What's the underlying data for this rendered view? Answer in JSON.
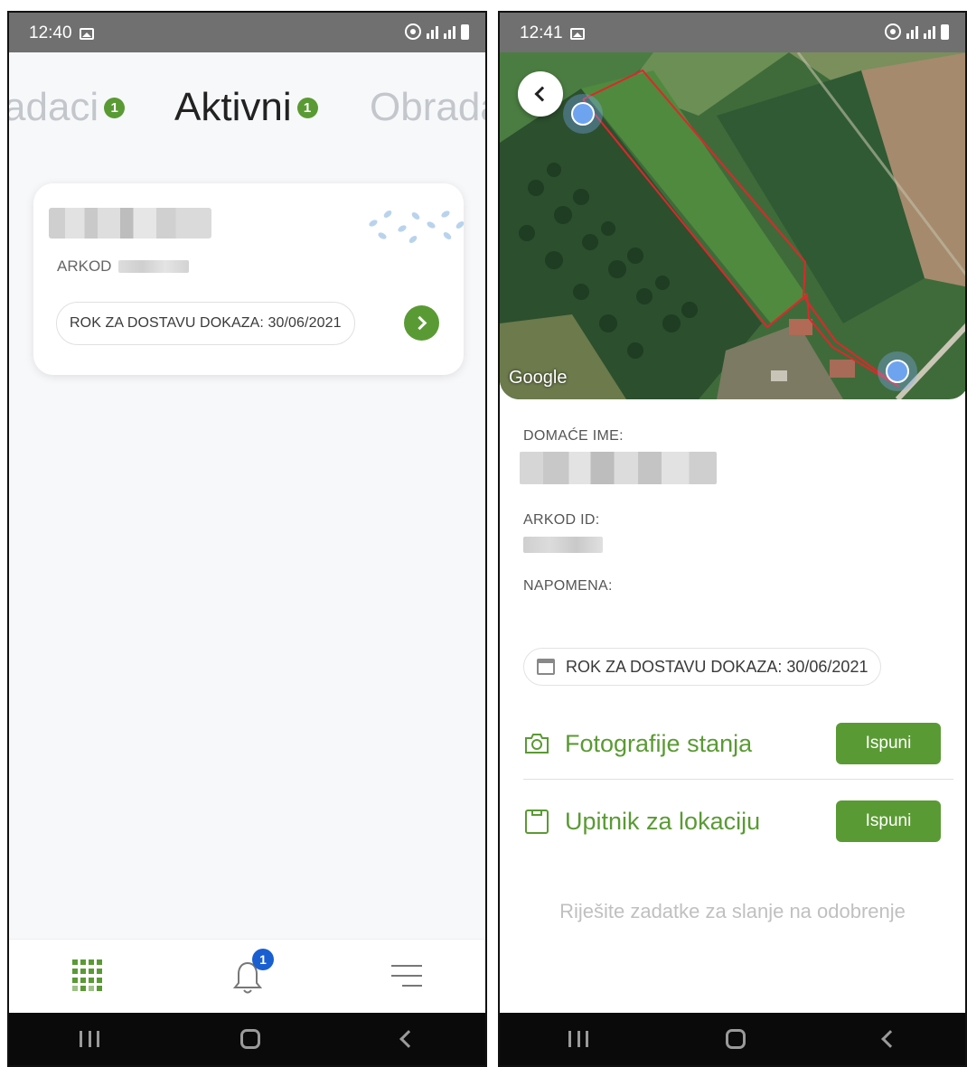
{
  "left_screen": {
    "status": {
      "time": "12:40"
    },
    "tabs": [
      {
        "label": "adaci",
        "count": "1"
      },
      {
        "label": "Aktivni",
        "count": "1"
      },
      {
        "label": "Obrada"
      }
    ],
    "card": {
      "arkod_label": "ARKOD",
      "deadline": "ROK ZA DOSTAVU DOKAZA: 30/06/2021"
    },
    "bottom_nav": {
      "notification_count": "1"
    }
  },
  "right_screen": {
    "status": {
      "time": "12:41"
    },
    "map": {
      "attribution": "Google"
    },
    "fields": {
      "domestic_name_label": "DOMAĆE IME:",
      "arkod_id_label": "ARKOD ID:",
      "note_label": "NAPOMENA:"
    },
    "deadline": "ROK ZA DOSTAVU DOKAZA: 30/06/2021",
    "tasks": [
      {
        "label": "Fotografije stanja",
        "button": "Ispuni"
      },
      {
        "label": "Upitnik za lokaciju",
        "button": "Ispuni"
      }
    ],
    "hint": "Riješite zadatke za slanje na odobrenje"
  },
  "colors": {
    "accent": "#5a9a34",
    "badge_blue": "#1a5fd0",
    "status_bar": "#707070",
    "nav_bar": "#0a0a0a"
  },
  "icons": [
    "image-icon",
    "hotspot-icon",
    "signal-icon",
    "battery-icon",
    "seeds-icon",
    "chevron-right-icon",
    "grid-icon",
    "bell-icon",
    "menu-icon",
    "back-arrow-icon",
    "calendar-icon",
    "camera-icon",
    "clipboard-icon"
  ]
}
